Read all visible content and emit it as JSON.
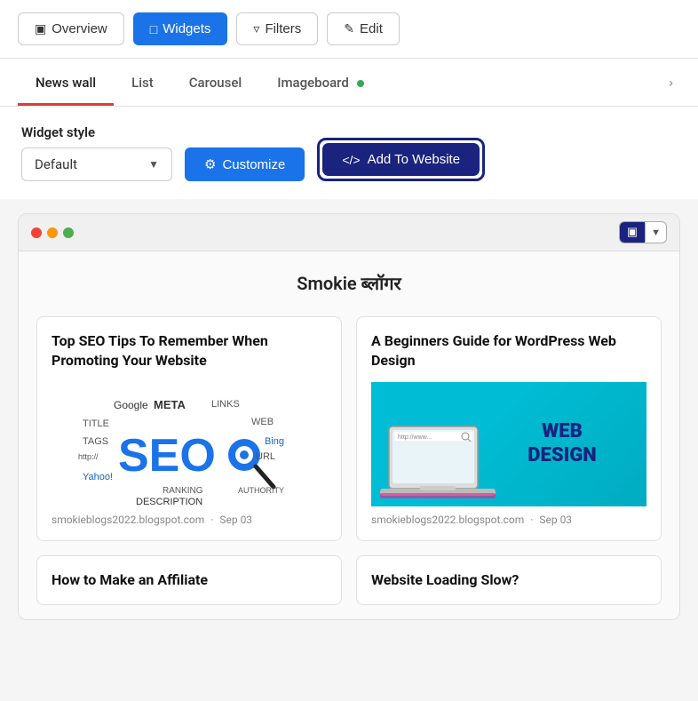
{
  "top_nav": {
    "overview_label": "Overview",
    "widgets_label": "Widgets",
    "filters_label": "Filters",
    "edit_label": "Edit"
  },
  "tabs": [
    {
      "id": "news-wall",
      "label": "News wall",
      "active": true,
      "has_dot": false
    },
    {
      "id": "list",
      "label": "List",
      "active": false,
      "has_dot": false
    },
    {
      "id": "carousel",
      "label": "Carousel",
      "active": false,
      "has_dot": false
    },
    {
      "id": "imageboard",
      "label": "Imageboard",
      "active": false,
      "has_dot": true
    }
  ],
  "widget_section": {
    "style_label": "Widget style",
    "dropdown_value": "Default",
    "customize_label": "Customize",
    "add_to_website_label": "Add To Website"
  },
  "preview": {
    "blog_title": "Smokie ब्लॉगर",
    "cards": [
      {
        "id": "card-1",
        "title": "Top SEO Tips To Remember When Promoting Your Website",
        "image_type": "seo",
        "meta_source": "smokieblogs2022.blogspot.com",
        "meta_date": "Sep 03"
      },
      {
        "id": "card-2",
        "title": "A Beginners Guide for WordPress Web Design",
        "image_type": "web-design",
        "meta_source": "smokieblogs2022.blogspot.com",
        "meta_date": "Sep 03"
      },
      {
        "id": "card-3",
        "title": "How to Make an Affiliate",
        "image_type": "none",
        "meta_source": "",
        "meta_date": ""
      },
      {
        "id": "card-4",
        "title": "Website Loading Slow?",
        "image_type": "none",
        "meta_source": "",
        "meta_date": ""
      }
    ]
  }
}
